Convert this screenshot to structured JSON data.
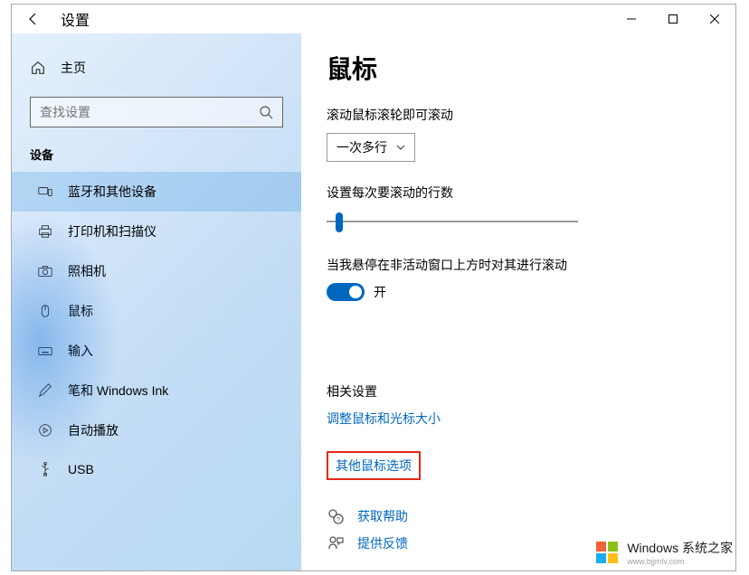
{
  "titlebar": {
    "settings_label": "设置"
  },
  "sidebar": {
    "home_label": "主页",
    "search_placeholder": "查找设置",
    "category_label": "设备",
    "items": [
      {
        "label": "蓝牙和其他设备"
      },
      {
        "label": "打印机和扫描仪"
      },
      {
        "label": "照相机"
      },
      {
        "label": "鼠标"
      },
      {
        "label": "输入"
      },
      {
        "label": "笔和 Windows Ink"
      },
      {
        "label": "自动播放"
      },
      {
        "label": "USB"
      }
    ]
  },
  "main": {
    "title": "鼠标",
    "scroll_section_label": "滚动鼠标滚轮即可滚动",
    "scroll_dropdown_value": "一次多行",
    "lines_label": "设置每次要滚动的行数",
    "inactive_label": "当我悬停在非活动窗口上方时对其进行滚动",
    "toggle_state": "开",
    "related_title": "相关设置",
    "link_cursor_size": "调整鼠标和光标大小",
    "link_other_options": "其他鼠标选项",
    "get_help": "获取帮助",
    "give_feedback": "提供反馈"
  },
  "watermark": {
    "line1": "Windows 系统之家",
    "line2": "www.bjjmlv.com"
  }
}
